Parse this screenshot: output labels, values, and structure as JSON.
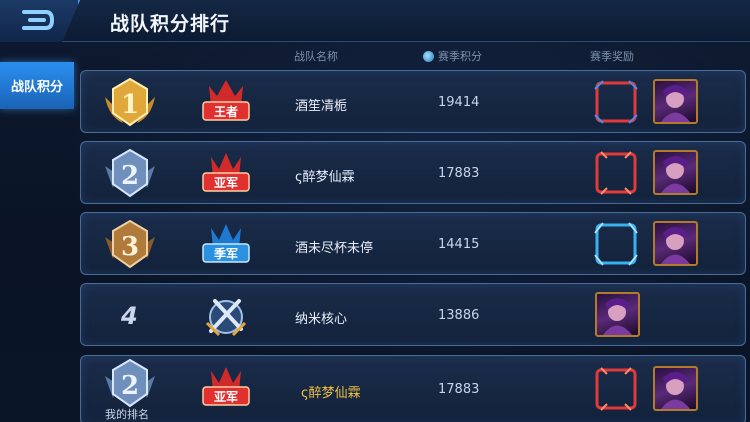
{
  "header": {
    "title": "战队积分排行"
  },
  "sidebar": {
    "items": [
      {
        "label": "战队积分"
      }
    ]
  },
  "columns": {
    "name": "战队名称",
    "score": "赛季积分",
    "reward": "赛季奖励"
  },
  "rows": [
    {
      "rank": "1",
      "emblem": "王者",
      "name": "酒笙凊栀",
      "score": "19414",
      "frame_color": "#e03a3a"
    },
    {
      "rank": "2",
      "emblem": "亚军",
      "name": "ς醉梦仙霖",
      "score": "17883",
      "frame_color": "#e03a3a"
    },
    {
      "rank": "3",
      "emblem": "季军",
      "name": "酒未尽杯未停",
      "score": "14415",
      "frame_color": "#3ab0f0"
    },
    {
      "rank": "4",
      "name": "纳米核心",
      "score": "13886"
    }
  ],
  "my_rank": {
    "rank": "2",
    "label": "我的排名",
    "emblem": "亚军",
    "name": "ς醉梦仙霖",
    "score": "17883",
    "frame_color": "#e03a3a",
    "name_color": "#f0c040"
  },
  "icons": {
    "back": "back-arrow-icon",
    "score": "season-score-icon"
  }
}
